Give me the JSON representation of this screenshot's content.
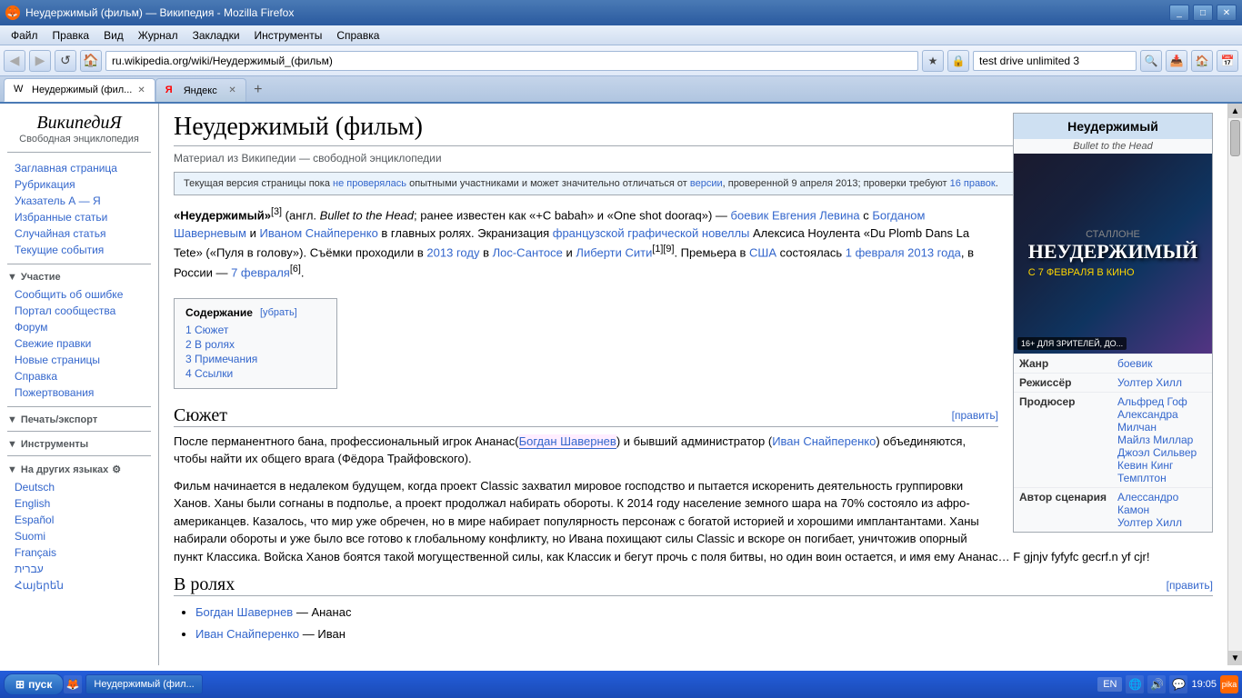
{
  "browser": {
    "title": "Неудержимый (фильм) — Википедия - Mozilla Firefox",
    "menu_items": [
      "Файл",
      "Правка",
      "Вид",
      "Журнал",
      "Закладки",
      "Инструменты",
      "Справка"
    ],
    "address": "ru.wikipedia.org/wiki/Неудержимый_(фильм)",
    "search_placeholder": "test drive unlimited 3",
    "nav_buttons": [
      "◀",
      "▶",
      "↺",
      "🏠"
    ],
    "tabs": [
      {
        "label": "Неудержимый (фил...",
        "type": "wikipedia",
        "active": true
      },
      {
        "label": "Яндекс",
        "type": "yandex",
        "active": false
      }
    ],
    "new_tab_label": "+"
  },
  "wikipedia": {
    "logo_title": "ВикипедиЯ",
    "logo_subtitle": "Свободная энциклопедия",
    "nav_items": [
      {
        "label": "Заглавная страница"
      },
      {
        "label": "Рубрикация"
      },
      {
        "label": "Указатель А — Я"
      },
      {
        "label": "Избранные статьи"
      },
      {
        "label": "Случайная статья"
      },
      {
        "label": "Текущие события"
      }
    ],
    "participate_header": "Участие",
    "participate_items": [
      {
        "label": "Сообщить об ошибке"
      },
      {
        "label": "Портал сообщества"
      },
      {
        "label": "Форум"
      },
      {
        "label": "Свежие правки"
      },
      {
        "label": "Новые страницы"
      },
      {
        "label": "Справка"
      },
      {
        "label": "Пожертвования"
      }
    ],
    "print_header": "Печать/экспорт",
    "tools_header": "Инструменты",
    "languages_header": "На других языках",
    "languages": [
      "Deutsch",
      "English",
      "Español",
      "Suomi",
      "Français",
      "עברית",
      "Հայերեն"
    ]
  },
  "page": {
    "title": "Неудержимый (фильм)",
    "subtitle": "Материал из Википедии — свободной энциклопедии",
    "edit_label": "[править]",
    "notice": "Текущая версия страницы пока не проверялась опытными участниками и может значительно отличаться от версии, проверенной 9 апреля 2013; проверки требуют 16 правок.",
    "intro": "«Неудержимый»[3] (англ. Bullet to the Head; ранее известен как «+С babah» и «One shot dooraq») — боевик Евгения Левина с Богданом Шаверневым и Иваном Снайперенко в главных ролях. Экранизация французской графической новеллы Алексиса Ноулента «Du Plomb Dans La Tete» («Пуля в голову»). Съёмки проходили в 2013 году в Лос-Сантосе и Либерти Сити[1][9]. Премьера в США состоялась 1 февраля 2013 года, в России — 7 февраля[6].",
    "toc": {
      "title": "Содержание",
      "hide_label": "[убрать]",
      "items": [
        {
          "num": "1",
          "label": "Сюжет"
        },
        {
          "num": "2",
          "label": "В ролях"
        },
        {
          "num": "3",
          "label": "Примечания"
        },
        {
          "num": "4",
          "label": "Ссылки"
        }
      ]
    },
    "section_syuzhet": "Сюжет",
    "syuzhet_text1": "После перманентного бана, профессиональный игрок Ананас(Богдан Шавернев) и бывший администратор (Иван Снайперенко) объединяются, чтобы найти их общего врага (Фёдора Трайфовского).",
    "syuzhet_text2": "Фильм начинается в недалеком будущем, когда проект Classic захватил мировое господство и пытается искоренить деятельность группировки Ханов. Ханы были согнаны в подполье, а проект продолжал набирать обороты. К 2014 году население земного шара на 70% состояло из афро-американцев. Казалось, что мир уже обречен, но в мире набирает популярность персонаж с богатой историей и хорошими имплантантами. Ханы набирали обороты и уже было все готово к глобальному конфликту, но Ивана похищают силы Classic и вскоре он погибает, уничтожив опорный пункт Классика. Войска Ханов боятся такой могущественной силы, как Классик и бегут прочь с поля битвы, но один воин остается, и имя ему Ананас… F gjnjv fyfyfc gecrf.n yf cjr!",
    "section_roles": "В ролях",
    "cast": [
      {
        "actor": "Богдан Шавернев",
        "role": "Ананас"
      },
      {
        "actor": "Иван Снайперенко",
        "role": "Иван"
      }
    ]
  },
  "infobox": {
    "title": "Неудержимый",
    "subtitle": "Bullet to the Head",
    "rating_label": "16+",
    "rows": [
      {
        "label": "Жанр",
        "value": "боевик"
      },
      {
        "label": "Режиссёр",
        "value": "Уолтер Хилл"
      },
      {
        "label": "Продюсер",
        "value": "Альфред Гоф\nАлександра Милчан\nМайлз Миллар\nДжоэл Сильвер\nКевин Кинг Темплтон"
      },
      {
        "label": "Автор сценария",
        "value": "Алессандро Камон\nУолтер Хилл"
      }
    ]
  },
  "taskbar": {
    "start_label": "пуск",
    "browser_btn": "Неудержимый (фил...",
    "lang": "EN",
    "time": "19:05"
  }
}
